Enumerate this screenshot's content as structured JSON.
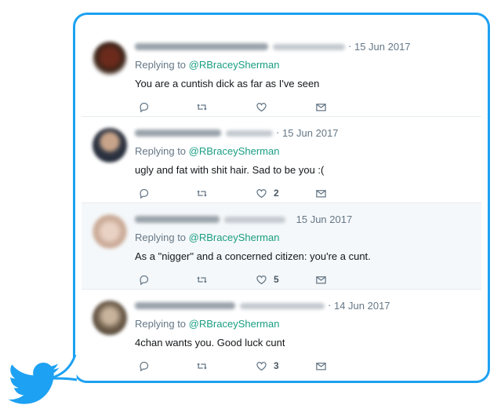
{
  "tweets": [
    {
      "date": "15 Jun 2017",
      "replying_prefix": "Replying to",
      "replying_handle": "@RBraceySherman",
      "text": "You are a cuntish dick as far as I've seen",
      "likes": "",
      "highlighted": false
    },
    {
      "date": "15 Jun 2017",
      "replying_prefix": "Replying to",
      "replying_handle": "@RBraceySherman",
      "text": "ugly and fat with shit hair. Sad to be you :(",
      "likes": "2",
      "highlighted": false
    },
    {
      "date": "15 Jun 2017",
      "replying_prefix": "Replying to",
      "replying_handle": "@RBraceySherman",
      "text": "As a \"nigger\" and a concerned citizen: you're a cunt.",
      "likes": "5",
      "highlighted": true
    },
    {
      "date": "14 Jun 2017",
      "replying_prefix": "Replying to",
      "replying_handle": "@RBraceySherman",
      "text": "4chan wants you.  Good luck cunt",
      "likes": "3",
      "highlighted": false
    }
  ],
  "icons": {
    "reply": "reply-icon",
    "retweet": "retweet-icon",
    "like": "heart-icon",
    "message": "envelope-icon",
    "logo": "twitter-bird-icon"
  },
  "colors": {
    "brand": "#1da1f2",
    "handle": "#1a9e83",
    "highlight_bg": "#f5f8fa"
  }
}
